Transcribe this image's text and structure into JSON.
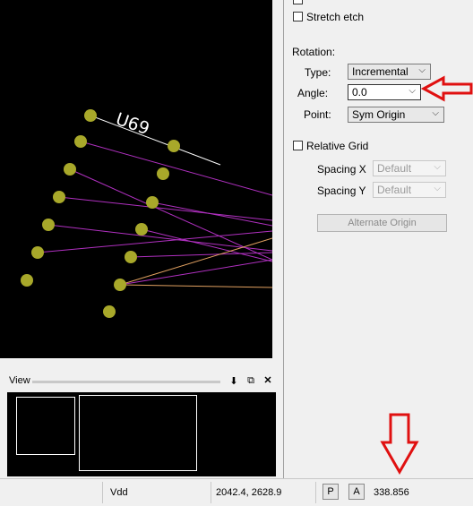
{
  "options": {
    "stretch_etch": "Stretch etch",
    "rotation_heading": "Rotation:",
    "type_label": "Type:",
    "type_value": "Incremental",
    "angle_label": "Angle:",
    "angle_value": "0.0",
    "point_label": "Point:",
    "point_value": "Sym Origin",
    "relative_grid": "Relative Grid",
    "spacing_x_label": "Spacing",
    "spacing_x_axis": "X",
    "spacing_x_value": "Default",
    "spacing_y_label": "Spacing",
    "spacing_y_axis": "Y",
    "spacing_y_value": "Default",
    "alternate_origin": "Alternate Origin"
  },
  "view": {
    "label": "View",
    "pin_icon": "pin-icon",
    "restore_icon": "restore-icon",
    "close_icon": "close-icon"
  },
  "canvas": {
    "refdes": "U69",
    "pin_color": "#a8a82a",
    "rat_color": "#b030c0",
    "trace_color": "#e0a060"
  },
  "status": {
    "net": "Vdd",
    "coords": "2042.4, 2628.9",
    "p_button": "P",
    "a_button": "A",
    "value": "338.856"
  },
  "annotations": {
    "arrow_color": "#e01010"
  }
}
